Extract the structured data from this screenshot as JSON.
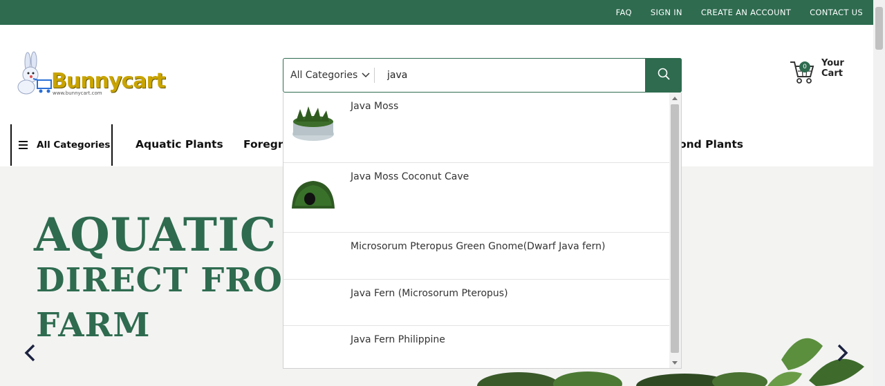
{
  "topbar": {
    "links": [
      "FAQ",
      "SIGN IN",
      "CREATE AN ACCOUNT",
      "CONTACT US"
    ]
  },
  "logo": {
    "text": "Bunnycart",
    "url_text": "www.bunnycart.com"
  },
  "search": {
    "category": "All Categories",
    "value": "java",
    "placeholder": ""
  },
  "cart": {
    "label": "Your Cart",
    "count": "0"
  },
  "nav": {
    "all_categories": "All Categories",
    "items": [
      "Aquatic Plants",
      "Foregro",
      "ond Plants"
    ]
  },
  "hero": {
    "line1": "AQUATIC P",
    "line2": "DIRECT FROM",
    "line3": "FARM"
  },
  "suggestions": [
    {
      "label": "Java Moss",
      "thumb": "java-moss-cup-thumbnail"
    },
    {
      "label": "Java Moss Coconut Cave",
      "thumb": "coconut-cave-thumbnail"
    },
    {
      "label": "Microsorum Pteropus Green Gnome(Dwarf Java fern)",
      "thumb": ""
    },
    {
      "label": "Java Fern (Microsorum Pteropus)",
      "thumb": ""
    },
    {
      "label": "Java Fern Philippine",
      "thumb": ""
    }
  ],
  "colors": {
    "brand_green": "#2e6b4f",
    "hero_bg": "#f3f3f2"
  }
}
